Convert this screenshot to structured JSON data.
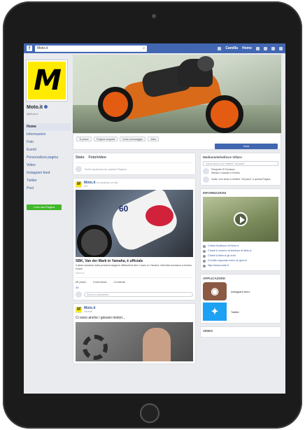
{
  "topbar": {
    "search_value": "Moto.it",
    "user": "Camilla",
    "home": "Home"
  },
  "page": {
    "name": "Moto.it",
    "handle": "@Moto.it",
    "logo_letter": "M"
  },
  "menu": [
    "Home",
    "Informazioni",
    "Foto",
    "Eventi",
    "Personalizza pagina",
    "Video",
    "Instagram feed",
    "Twitter",
    "Post"
  ],
  "create_page": "Crea una Pagina",
  "actions": {
    "like": "Ti piace",
    "follow": "Pagina seguita",
    "message": "Invia messaggio",
    "more": "Altro",
    "send": "Invia"
  },
  "composer": {
    "tab_status": "Stato",
    "tab_photo": "Foto/video",
    "placeholder": "Scrivi qualcosa su questa Pagina..."
  },
  "post1": {
    "author": "Moto.it",
    "meta": "ha condiviso un link",
    "time": "Ieri",
    "bike_number": "60",
    "title": "SBK, Van der Mark in Yamaha, è ufficiale",
    "desc": "Il pilota olandese dalla prossima stagione affiancherà Alex Lowes su Yamaha. Intervista esclusiva a Andrea Dosoli",
    "url": "MOTO.IT",
    "like": "Mi piace",
    "comment": "Commenta",
    "share": "Condividi",
    "likes": "45",
    "comment_placeholder": "Scrivi un commento..."
  },
  "post2": {
    "author": "Moto.it",
    "time": "Venerdì",
    "text": "Ci sono anche i giovani motori..."
  },
  "sidebar": {
    "invite_title": "Mediumelet/editore Villaro",
    "search_placeholder": "Cerca amici a cui mettere \"Mi piace\"",
    "friend_name": "Pasquale Di Tomasso",
    "friend_sub": "Stefano Graziato e Evento",
    "friend_invite": "Invita i tuoi amici a mettere \"Mi piace\" a questa Pagina",
    "info_title": "INFORMAZIONI",
    "video_views": "47",
    "video_likes": "34",
    "info_links": [
      "Chiedi l'indirizzo di Moto.it",
      "Chiedi il numero di telefono di Moto.it",
      "Chiedi a Moto.it gli orari",
      "Di solito risponde entro un giorno",
      "http://www.moto.it"
    ],
    "apps_title": "APPLICAZIONI",
    "app1": "Instagram feed",
    "app2": "Twitter",
    "video_title": "VIDEO"
  }
}
